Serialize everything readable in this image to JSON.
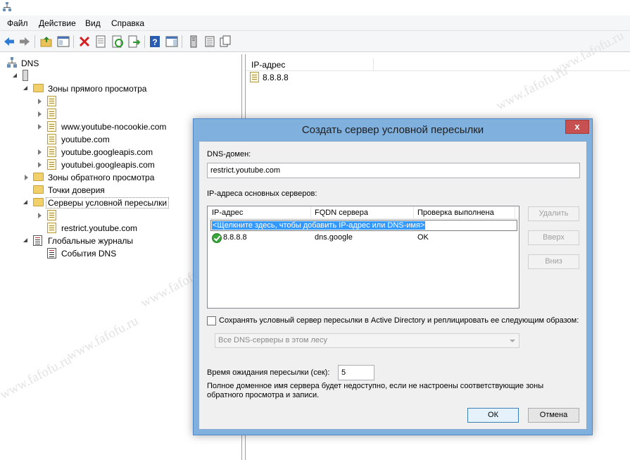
{
  "menu": [
    "Файл",
    "Действие",
    "Вид",
    "Справка"
  ],
  "toolbar_icons": [
    "back-icon",
    "forward-icon",
    "up-folder-icon",
    "show-hide-tree-icon",
    "delete-icon",
    "properties-icon",
    "refresh-icon",
    "export-list-icon",
    "help-icon",
    "action-pane-icon",
    "server-icon",
    "list-icon",
    "copy-icon"
  ],
  "tree": {
    "root": "DNS",
    "forward_zones": "Зоны прямого просмотра",
    "zones": [
      "www.youtube-nocookie.com",
      "youtube.com",
      "youtube.googleapis.com",
      "youtubei.googleapis.com"
    ],
    "reverse_zones": "Зоны обратного просмотра",
    "trust_points": "Точки доверия",
    "conditional_forwarders": "Серверы условной пересылки",
    "forwarder_zone": "restrict.youtube.com",
    "global_logs": "Глобальные журналы",
    "dns_events": "События DNS"
  },
  "right_pane": {
    "column_header": "IP-адрес",
    "items": [
      "8.8.8.8"
    ]
  },
  "dialog": {
    "title": "Создать сервер условной пересылки",
    "close": "x",
    "dns_domain_label": "DNS-домен:",
    "dns_domain_value": "restrict.youtube.com",
    "master_servers_label": "IP-адреса основных серверов:",
    "columns": [
      "IP-адрес",
      "FQDN сервера",
      "Проверка выполнена"
    ],
    "edit_row": "<Щелкните здесь, чтобы добавить IP-адрес или DNS-имя>",
    "rows": [
      {
        "ip": "8.8.8.8",
        "fqdn": "dns.google",
        "validated": "OK"
      }
    ],
    "buttons": {
      "delete": "Удалить",
      "up": "Вверх",
      "down": "Вниз",
      "ok": "ОК",
      "cancel": "Отмена"
    },
    "ad_checkbox_label": "Сохранять условный сервер пересылки в Active Directory и реплицировать ее следующим образом:",
    "ad_checkbox_checked": false,
    "replication_scope": "Все DNS-серверы в этом лесу",
    "timeout_label": "Время ожидания пересылки (сек):",
    "timeout_value": "5",
    "note": "Полное доменное имя сервера будет недоступно, если не настроены соответствующие зоны обратного просмотра и записи."
  },
  "watermark": "www.fafofu.ru"
}
